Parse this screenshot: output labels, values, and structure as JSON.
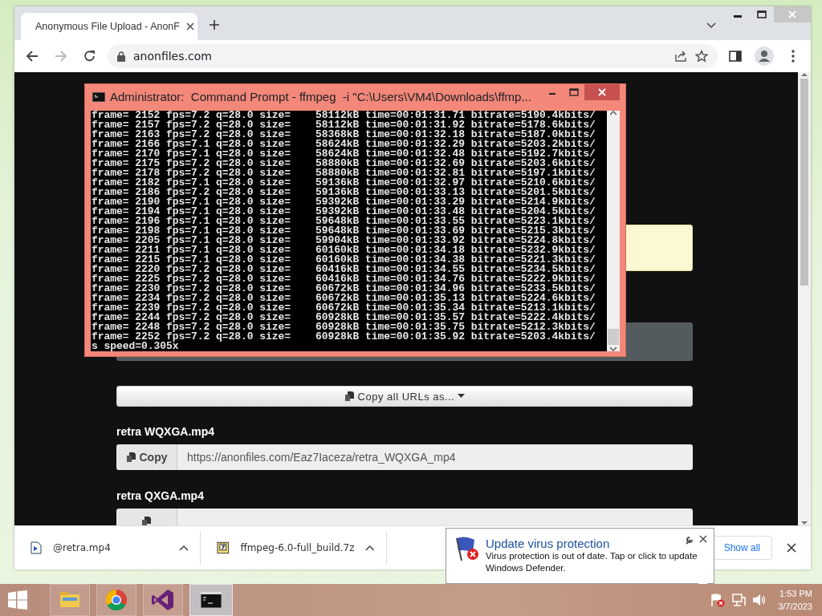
{
  "browser": {
    "tab": {
      "title": "Anonymous File Upload - AnonF",
      "selected": true
    },
    "address": "anonfiles.com"
  },
  "page": {
    "copy_all_button": "Copy all URLs as...",
    "files": [
      {
        "name": "retra WQXGA.mp4",
        "copy_label": "Copy",
        "url": "https://anonfiles.com/Eaz7Iaceza/retra_WQXGA_mp4"
      },
      {
        "name": "retra QXGA.mp4"
      }
    ]
  },
  "console": {
    "title": "Administrator:  Command Prompt - ffmpeg  -i \"C:\\Users\\VM4\\Downloads\\ffmp...",
    "lines": [
      "frame= 2152 fps=7.2 q=28.0 size=    58112kB time=00:01:31.71 bitrate=5190.4kbits/",
      "frame= 2157 fps=7.2 q=28.0 size=    58112kB time=00:01:31.92 bitrate=5178.6kbits/",
      "frame= 2163 fps=7.2 q=28.0 size=    58368kB time=00:01:32.18 bitrate=5187.0kbits/",
      "frame= 2166 fps=7.1 q=28.0 size=    58624kB time=00:01:32.29 bitrate=5203.2kbits/",
      "frame= 2170 fps=7.1 q=28.0 size=    58624kB time=00:01:32.48 bitrate=5192.7kbits/",
      "frame= 2175 fps=7.2 q=28.0 size=    58880kB time=00:01:32.69 bitrate=5203.6kbits/",
      "frame= 2178 fps=7.2 q=28.0 size=    58880kB time=00:01:32.81 bitrate=5197.1kbits/",
      "frame= 2182 fps=7.1 q=28.0 size=    59136kB time=00:01:32.97 bitrate=5210.6kbits/",
      "frame= 2186 fps=7.2 q=28.0 size=    59136kB time=00:01:33.13 bitrate=5201.5kbits/",
      "frame= 2190 fps=7.1 q=28.0 size=    59392kB time=00:01:33.29 bitrate=5214.9kbits/",
      "frame= 2194 fps=7.1 q=28.0 size=    59392kB time=00:01:33.48 bitrate=5204.5kbits/",
      "frame= 2196 fps=7.1 q=28.0 size=    59648kB time=00:01:33.55 bitrate=5223.1kbits/",
      "frame= 2198 fps=7.1 q=28.0 size=    59648kB time=00:01:33.69 bitrate=5215.3kbits/",
      "frame= 2205 fps=7.1 q=28.0 size=    59904kB time=00:01:33.92 bitrate=5224.8kbits/",
      "frame= 2211 fps=7.1 q=28.0 size=    60160kB time=00:01:34.18 bitrate=5232.9kbits/",
      "frame= 2215 fps=7.1 q=28.0 size=    60160kB time=00:01:34.38 bitrate=5221.3kbits/",
      "frame= 2220 fps=7.2 q=28.0 size=    60416kB time=00:01:34.55 bitrate=5234.5kbits/",
      "frame= 2225 fps=7.2 q=28.0 size=    60416kB time=00:01:34.76 bitrate=5222.9kbits/",
      "frame= 2230 fps=7.2 q=28.0 size=    60672kB time=00:01:34.96 bitrate=5233.5kbits/",
      "frame= 2234 fps=7.2 q=28.0 size=    60672kB time=00:01:35.13 bitrate=5224.6kbits/",
      "frame= 2239 fps=7.2 q=28.0 size=    60672kB time=00:01:35.34 bitrate=5213.1kbits/",
      "frame= 2244 fps=7.2 q=28.0 size=    60928kB time=00:01:35.57 bitrate=5222.4kbits/",
      "frame= 2248 fps=7.2 q=28.0 size=    60928kB time=00:01:35.75 bitrate=5212.3kbits/",
      "frame= 2252 fps=7.2 q=28.0 size=    60928kB time=00:01:35.92 bitrate=5203.4kbits/",
      "s speed=0.305x"
    ]
  },
  "downloads": {
    "items": [
      {
        "name": "@retra.mp4",
        "kind": "video"
      },
      {
        "name": "ffmpeg-6.0-full_build.7z",
        "kind": "archive"
      }
    ],
    "show_all": "Show all"
  },
  "notification": {
    "title": "Update virus protection",
    "body": "Virus protection is out of date. Tap or click to update Windows Defender."
  },
  "taskbar": {
    "apps": [
      {
        "kind": "explorer",
        "selected": false
      },
      {
        "kind": "chrome",
        "selected": false
      },
      {
        "kind": "studio",
        "selected": false
      },
      {
        "kind": "console",
        "selected": true
      }
    ],
    "time": "1:53 PM",
    "date": "3/7/2023"
  }
}
